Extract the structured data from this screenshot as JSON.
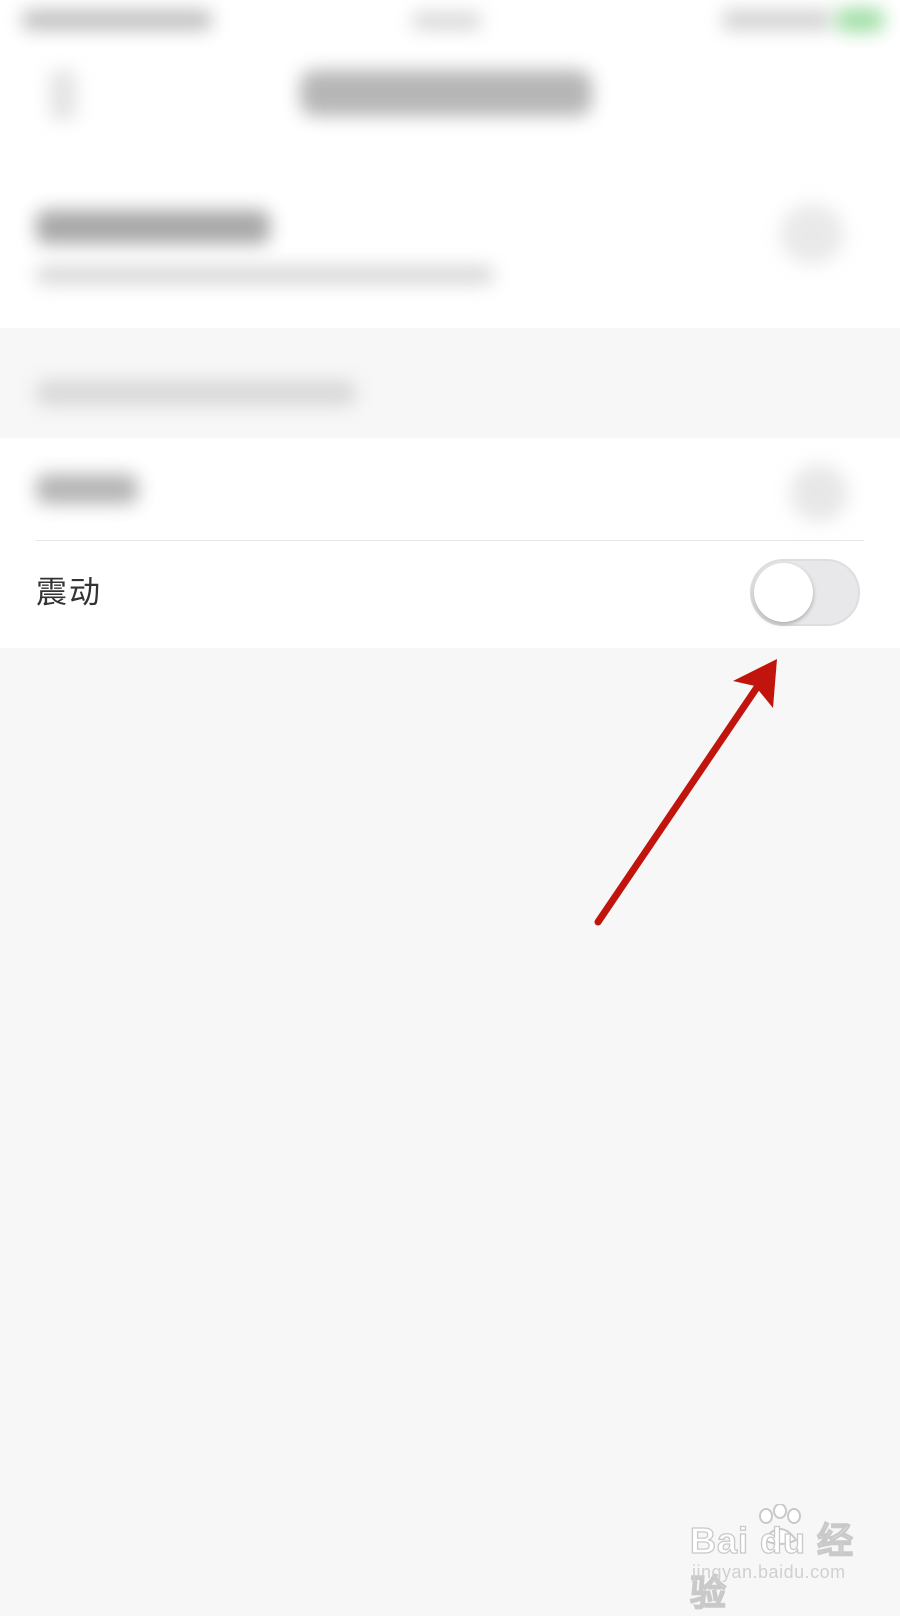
{
  "settings": {
    "vibrate_label": "震动",
    "vibrate_enabled": false
  },
  "colors": {
    "background": "#f7f7f7",
    "row_background": "#ffffff",
    "toggle_off_track": "#e8e8ea",
    "annotation_arrow": "#c0140c"
  },
  "watermark": {
    "brand": "Bai du 经验",
    "url": "jingyan.baidu.com"
  }
}
